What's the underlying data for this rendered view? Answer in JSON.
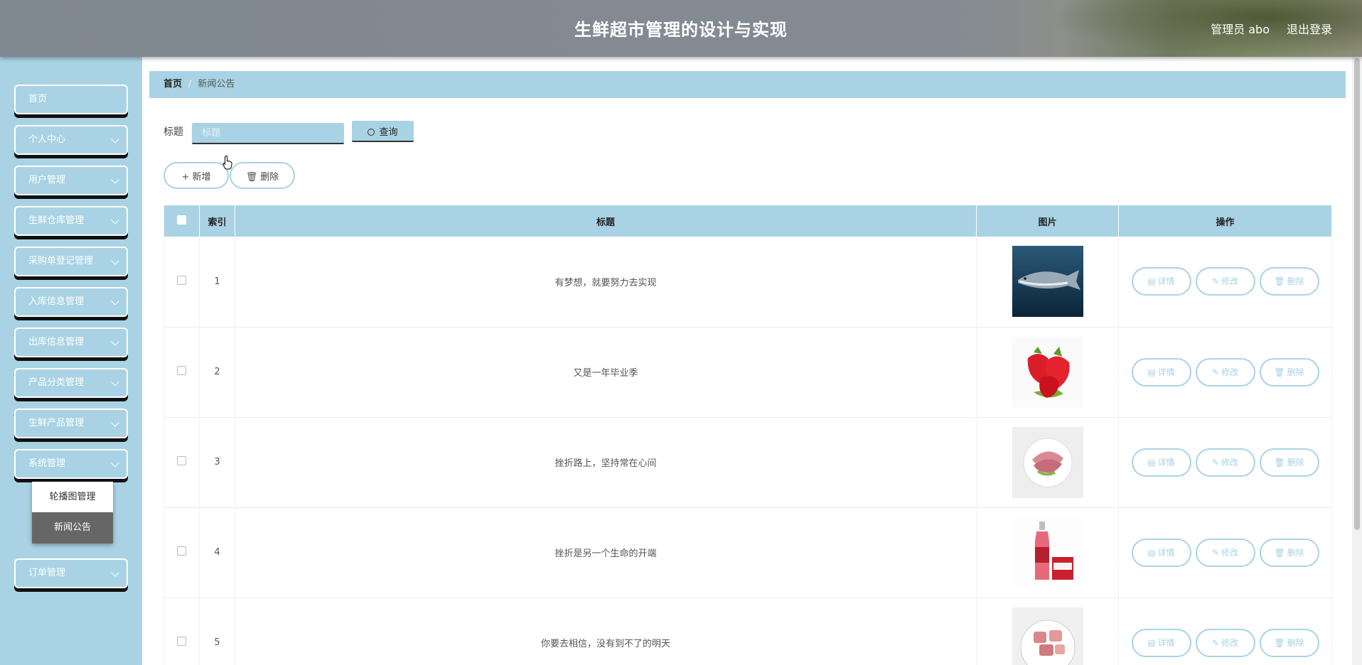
{
  "header": {
    "title": "生鲜超市管理的设计与实现",
    "user": "管理员 abo",
    "logout": "退出登录"
  },
  "sidebar": {
    "items": [
      {
        "label": "首页"
      },
      {
        "label": "个人中心"
      },
      {
        "label": "用户管理"
      },
      {
        "label": "生鲜仓库管理"
      },
      {
        "label": "采购单登记管理"
      },
      {
        "label": "入库信息管理"
      },
      {
        "label": "出库信息管理"
      },
      {
        "label": "产品分类管理"
      },
      {
        "label": "生鲜产品管理"
      },
      {
        "label": "系统管理"
      },
      {
        "label": "订单管理"
      }
    ],
    "submenu": [
      {
        "label": "轮播图管理"
      },
      {
        "label": "新闻公告"
      }
    ]
  },
  "breadcrumb": {
    "home": "首页",
    "separator": "/",
    "current": "新闻公告"
  },
  "search": {
    "label": "标题",
    "placeholder": "标题",
    "button": "查询"
  },
  "actions": {
    "add": "新增",
    "delete": "删除"
  },
  "table": {
    "headers": {
      "index": "索引",
      "title": "标题",
      "image": "图片",
      "ops": "操作"
    },
    "row_actions": {
      "detail": "详情",
      "edit": "修改",
      "delete": "删除"
    },
    "rows": [
      {
        "index": "1",
        "title": "有梦想，就要努力去实现",
        "image": "fish-image"
      },
      {
        "index": "2",
        "title": "又是一年毕业季",
        "image": "strawberry-image"
      },
      {
        "index": "3",
        "title": "挫折路上，坚持常在心间",
        "image": "ham-plate-image"
      },
      {
        "index": "4",
        "title": "挫折是另一个生命的开端",
        "image": "juice-bottle-image"
      },
      {
        "index": "5",
        "title": "你要去相信，没有到不了的明天",
        "image": "meat-plate-image"
      }
    ]
  },
  "colors": {
    "accent": "#a9d3e4",
    "header_bg": "#858b92"
  }
}
